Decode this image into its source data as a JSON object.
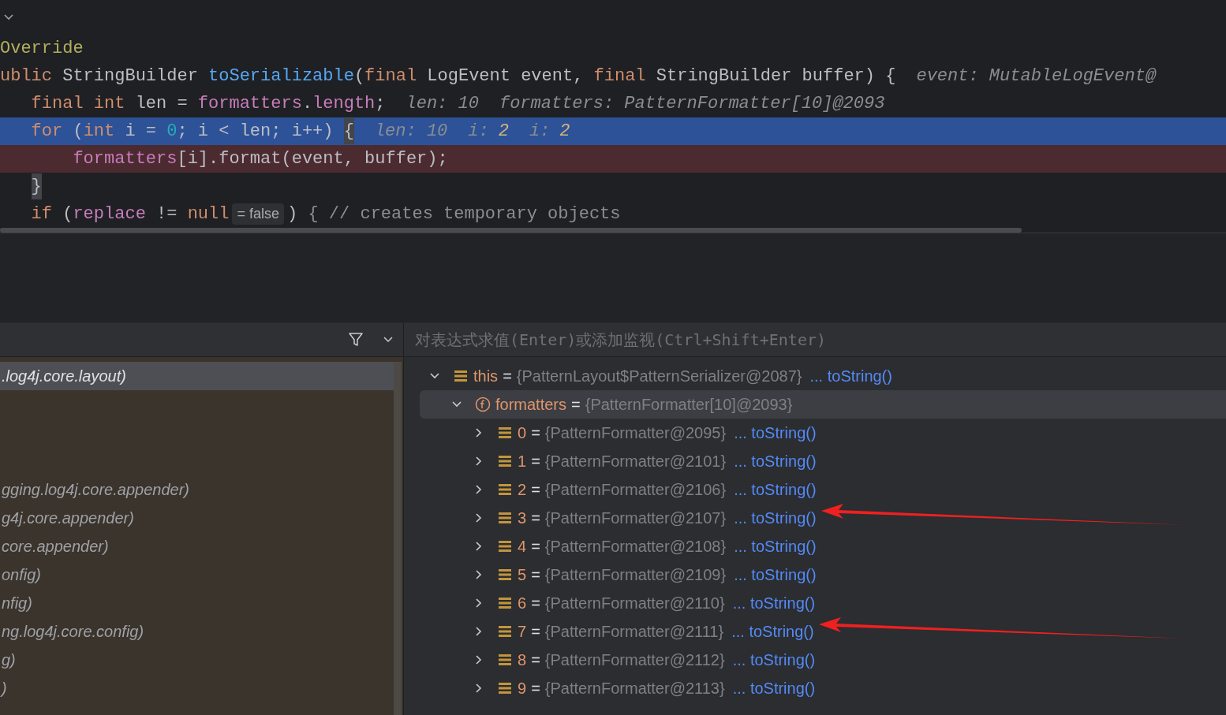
{
  "editor": {
    "lines": [
      {
        "kind": "normal",
        "tokens": [
          {
            "kind": "annotation",
            "text": "Override"
          }
        ]
      },
      {
        "kind": "normal",
        "tokens": [
          {
            "kind": "keyword",
            "text": "ublic"
          },
          {
            "kind": "plain",
            "text": " StringBuilder "
          },
          {
            "kind": "method",
            "text": "toSerializable"
          },
          {
            "kind": "plain",
            "text": "("
          },
          {
            "kind": "keyword",
            "text": "final"
          },
          {
            "kind": "plain",
            "text": " LogEvent event, "
          },
          {
            "kind": "keyword",
            "text": "final"
          },
          {
            "kind": "plain",
            "text": " StringBuilder buffer) {"
          },
          {
            "kind": "hint",
            "text": "event: MutableLogEvent@"
          }
        ]
      },
      {
        "kind": "normal",
        "tokens": [
          {
            "kind": "keyword",
            "text": "   final"
          },
          {
            "kind": "keyword",
            "text": " int"
          },
          {
            "kind": "plain",
            "text": " len = "
          },
          {
            "kind": "field",
            "text": "formatters"
          },
          {
            "kind": "plain",
            "text": "."
          },
          {
            "kind": "field",
            "text": "length"
          },
          {
            "kind": "plain",
            "text": ";"
          },
          {
            "kind": "hint",
            "text": "len: 10"
          },
          {
            "kind": "hint",
            "text": "formatters: PatternFormatter[10]@2093"
          }
        ]
      },
      {
        "kind": "execution",
        "tokens": [
          {
            "kind": "keyword",
            "text": "   for"
          },
          {
            "kind": "plain",
            "text": " ("
          },
          {
            "kind": "keyword",
            "text": "int"
          },
          {
            "kind": "plain",
            "text": " i = "
          },
          {
            "kind": "number",
            "text": "0"
          },
          {
            "kind": "plain",
            "text": "; i < len; i++) "
          },
          {
            "kind": "brace",
            "text": "{"
          },
          {
            "kind": "hint",
            "text": "len: 10"
          },
          {
            "kind": "hint",
            "text": "i:"
          },
          {
            "kind": "hint-value",
            "text": "2"
          },
          {
            "kind": "hint",
            "text": "i:"
          },
          {
            "kind": "hint-value",
            "text": "2"
          }
        ]
      },
      {
        "kind": "breakpoint",
        "tokens": [
          {
            "kind": "field",
            "text": "       formatters"
          },
          {
            "kind": "plain",
            "text": "[i].format(event, buffer);"
          }
        ]
      },
      {
        "kind": "normal",
        "tokens": [
          {
            "kind": "brace",
            "text": "   }"
          }
        ]
      },
      {
        "kind": "normal",
        "tokens": [
          {
            "kind": "keyword",
            "text": "   if"
          },
          {
            "kind": "plain",
            "text": " ("
          },
          {
            "kind": "field",
            "text": "replace"
          },
          {
            "kind": "plain",
            "text": " != "
          },
          {
            "kind": "keyword",
            "text": "null"
          },
          {
            "kind": "inline-value",
            "text": "= false"
          },
          {
            "kind": "plain",
            "text": ")"
          },
          {
            "kind": "comment",
            "text": " { // creates temporary objects"
          }
        ]
      }
    ]
  },
  "debugger": {
    "frames": [
      {
        "text": ".log4j.core.layout)",
        "selected": true
      },
      {
        "text": "gging.log4j.core.appender)",
        "selected": false
      },
      {
        "text": "g4j.core.appender)",
        "selected": false
      },
      {
        "text": "core.appender)",
        "selected": false
      },
      {
        "text": "onfig)",
        "selected": false
      },
      {
        "text": "nfig)",
        "selected": false
      },
      {
        "text": "ng.log4j.core.config)",
        "selected": false
      },
      {
        "text": "g)",
        "selected": false
      },
      {
        "text": ")",
        "selected": false
      }
    ],
    "expression_field": {
      "placeholder": "对表达式求值(Enter)或添加监视(Ctrl+Shift+Enter)"
    },
    "variables": [
      {
        "kind": "object",
        "name": "this",
        "equals": "=",
        "value": "{PatternLayout$PatternSerializer@2087}",
        "link": "... toString()",
        "expanded": true,
        "selected": false,
        "children": [
          {
            "kind": "field",
            "name": "formatters",
            "equals": "=",
            "value": "{PatternFormatter[10]@2093}",
            "expanded": true,
            "selected": true,
            "children": [
              {
                "kind": "object",
                "name": "0",
                "equals": "=",
                "value": "{PatternFormatter@2095}",
                "link": "... toString()",
                "expanded": false,
                "selected": false,
                "arrow": false
              },
              {
                "kind": "object",
                "name": "1",
                "equals": "=",
                "value": "{PatternFormatter@2101}",
                "link": "... toString()",
                "expanded": false,
                "selected": false,
                "arrow": false
              },
              {
                "kind": "object",
                "name": "2",
                "equals": "=",
                "value": "{PatternFormatter@2106}",
                "link": "... toString()",
                "expanded": false,
                "selected": false,
                "arrow": false
              },
              {
                "kind": "object",
                "name": "3",
                "equals": "=",
                "value": "{PatternFormatter@2107}",
                "link": "... toString()",
                "expanded": false,
                "selected": false,
                "arrow": true
              },
              {
                "kind": "object",
                "name": "4",
                "equals": "=",
                "value": "{PatternFormatter@2108}",
                "link": "... toString()",
                "expanded": false,
                "selected": false,
                "arrow": false
              },
              {
                "kind": "object",
                "name": "5",
                "equals": "=",
                "value": "{PatternFormatter@2109}",
                "link": "... toString()",
                "expanded": false,
                "selected": false,
                "arrow": false
              },
              {
                "kind": "object",
                "name": "6",
                "equals": "=",
                "value": "{PatternFormatter@2110}",
                "link": "... toString()",
                "expanded": false,
                "selected": false,
                "arrow": false
              },
              {
                "kind": "object",
                "name": "7",
                "equals": "=",
                "value": "{PatternFormatter@2111}",
                "link": "... toString()",
                "expanded": false,
                "selected": false,
                "arrow": true
              },
              {
                "kind": "object",
                "name": "8",
                "equals": "=",
                "value": "{PatternFormatter@2112}",
                "link": "... toString()",
                "expanded": false,
                "selected": false,
                "arrow": false
              },
              {
                "kind": "object",
                "name": "9",
                "equals": "=",
                "value": "{PatternFormatter@2113}",
                "link": "... toString()",
                "expanded": false,
                "selected": false,
                "arrow": false
              }
            ]
          }
        ]
      }
    ]
  }
}
